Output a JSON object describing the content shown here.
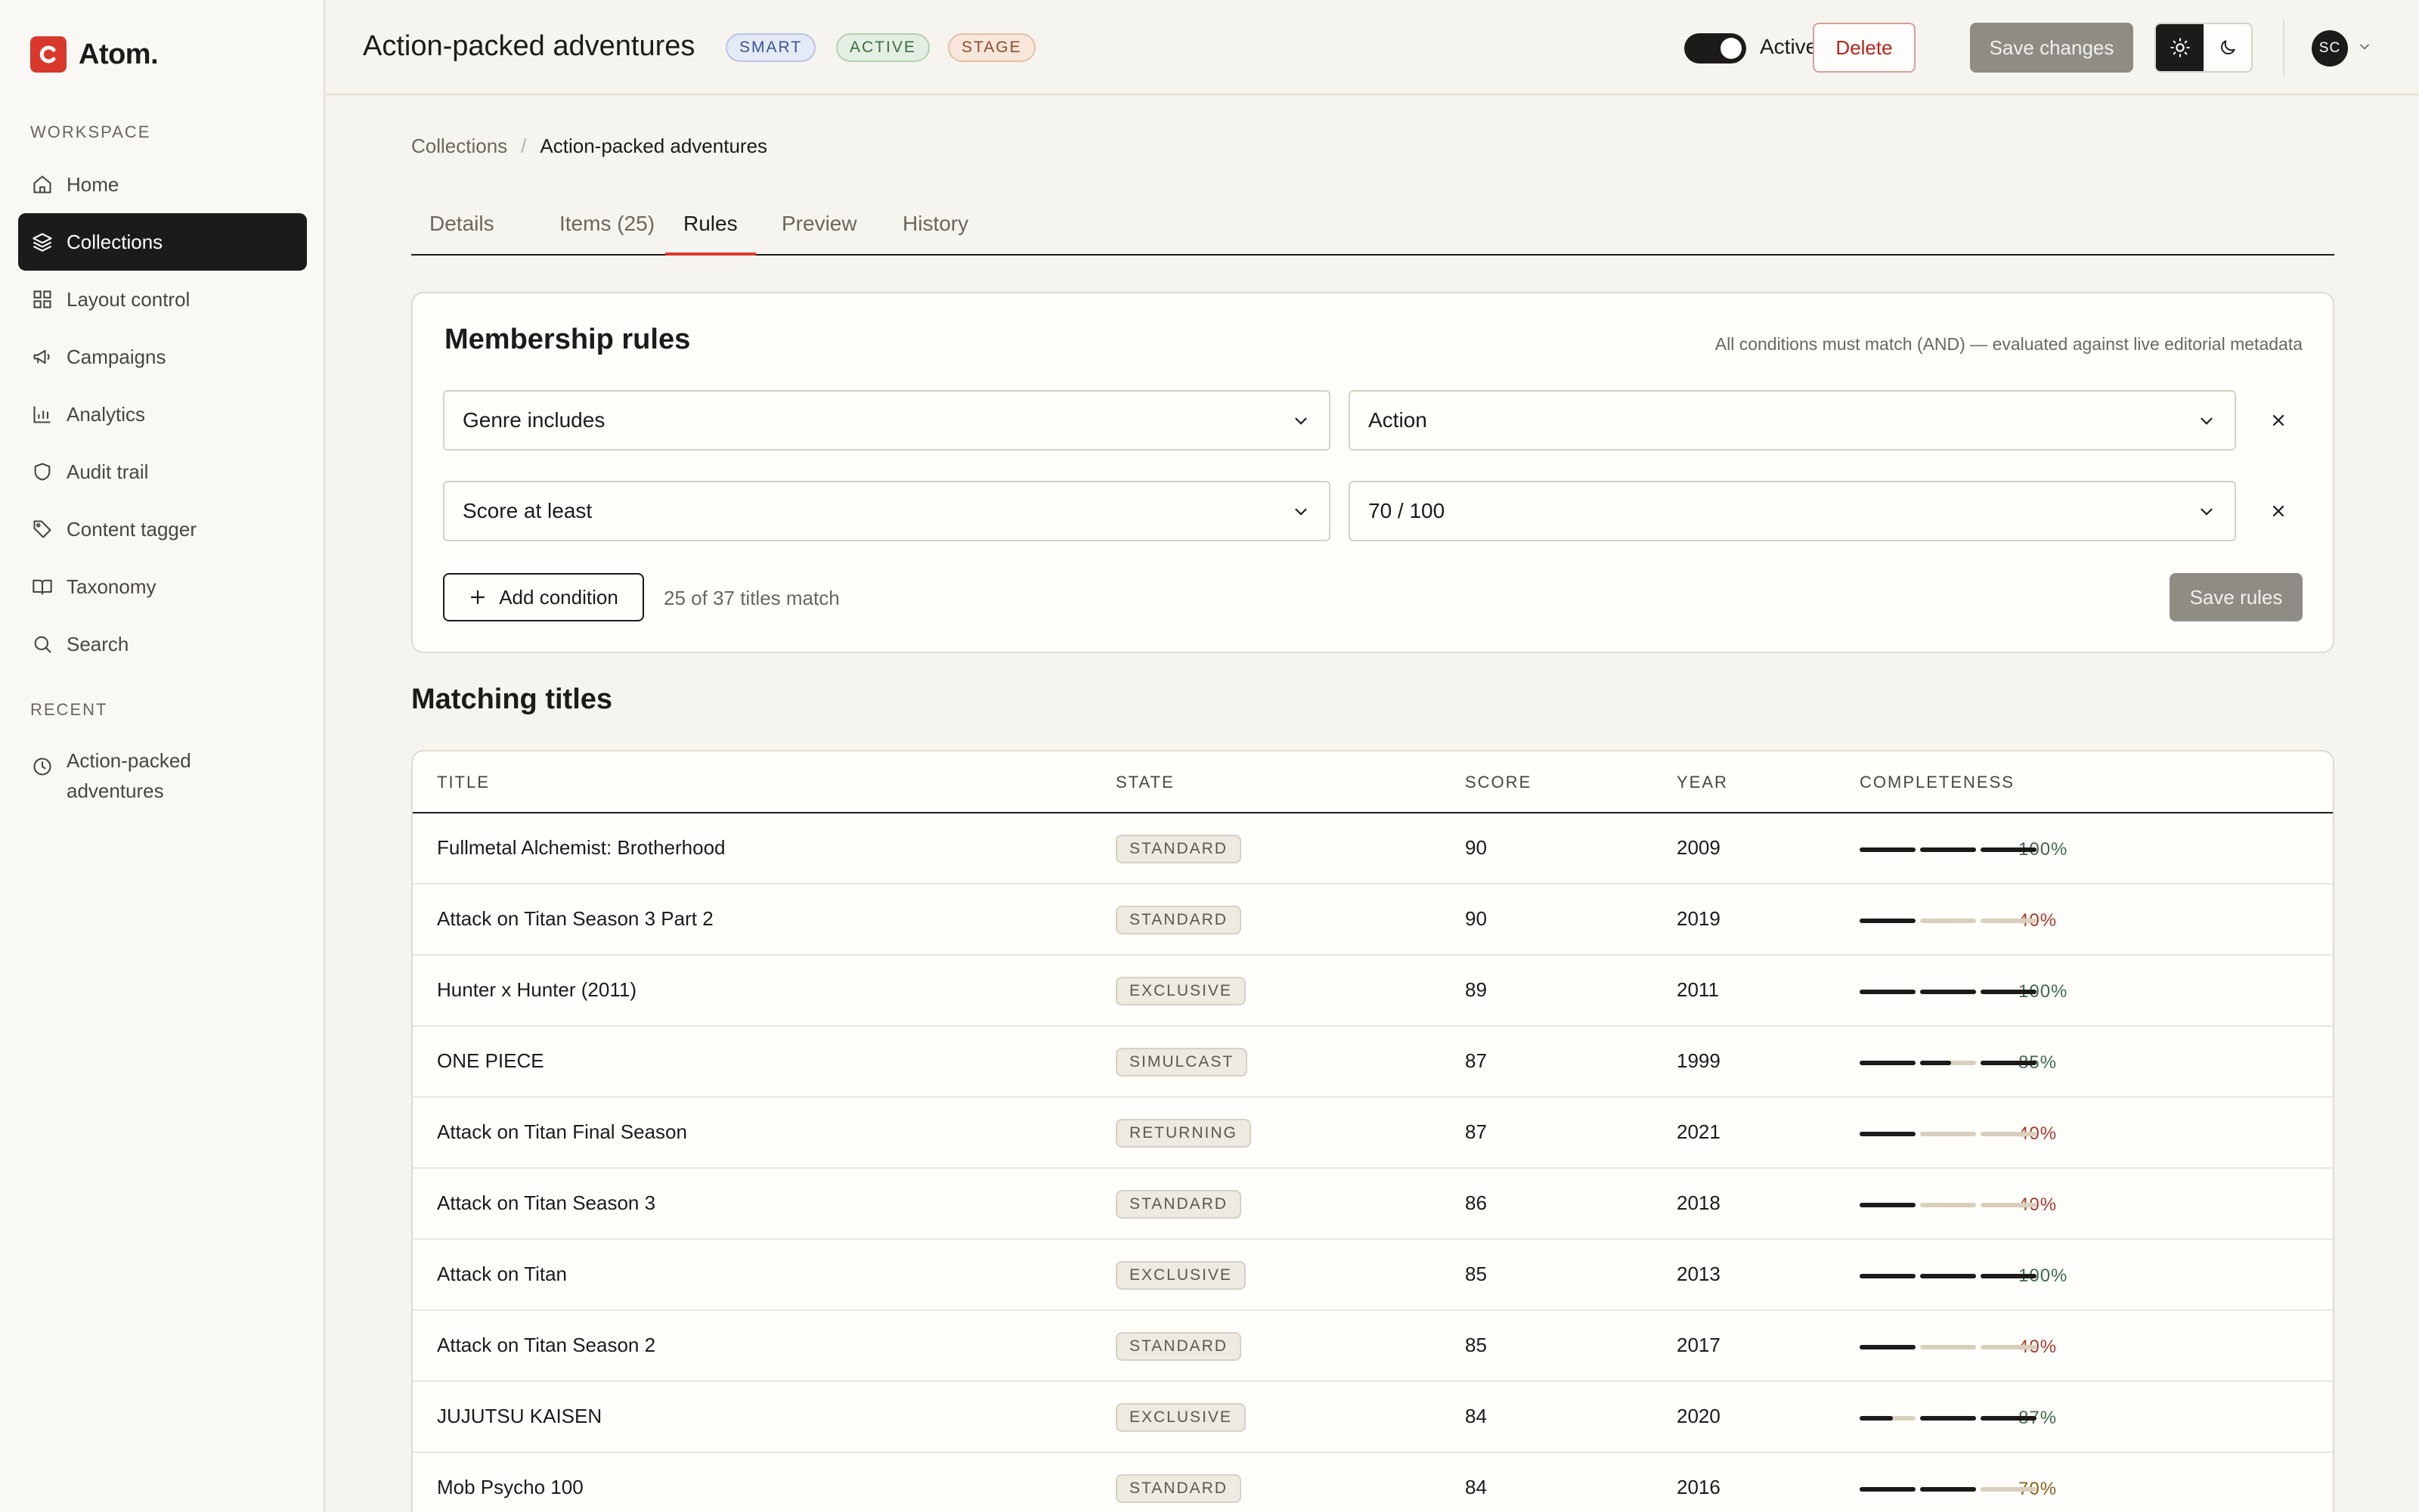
{
  "brand": {
    "name": "Atom."
  },
  "sidebar": {
    "workspace_label": "WORKSPACE",
    "items": [
      {
        "label": "Home",
        "icon": "home-icon"
      },
      {
        "label": "Collections",
        "icon": "layers-icon",
        "active": true
      },
      {
        "label": "Layout control",
        "icon": "grid-icon"
      },
      {
        "label": "Campaigns",
        "icon": "megaphone-icon"
      },
      {
        "label": "Analytics",
        "icon": "bar-chart-icon"
      },
      {
        "label": "Audit trail",
        "icon": "shield-icon"
      },
      {
        "label": "Content tagger",
        "icon": "tag-icon"
      },
      {
        "label": "Taxonomy",
        "icon": "book-icon"
      },
      {
        "label": "Search",
        "icon": "search-icon"
      }
    ],
    "recent_label": "RECENT",
    "recent_items": [
      {
        "label": "Action-packed adventures",
        "icon": "clock-icon"
      }
    ]
  },
  "header": {
    "title": "Action-packed adventures",
    "badges": [
      "SMART",
      "ACTIVE",
      "STAGE"
    ],
    "toggle_label": "Active",
    "toggle_on": true,
    "delete_label": "Delete",
    "save_label": "Save changes",
    "theme": "light",
    "avatar_initials": "SC"
  },
  "breadcrumb": {
    "parent": "Collections",
    "separator": "/",
    "current": "Action-packed adventures"
  },
  "tabs": [
    {
      "label": "Details"
    },
    {
      "label": "Items (25)"
    },
    {
      "label": "Rules",
      "active": true
    },
    {
      "label": "Preview"
    },
    {
      "label": "History"
    }
  ],
  "rules": {
    "title": "Membership rules",
    "note": "All conditions must match (AND) — evaluated against live editorial metadata",
    "conditions": [
      {
        "field": "Genre includes",
        "value": "Action"
      },
      {
        "field": "Score at least",
        "value": "70 / 100"
      }
    ],
    "add_label": "Add condition",
    "match_count": "25 of 37 titles match",
    "save_label": "Save rules"
  },
  "matching": {
    "title": "Matching titles",
    "columns": [
      "TITLE",
      "STATE",
      "SCORE",
      "YEAR",
      "COMPLETENESS"
    ],
    "rows": [
      {
        "title": "Fullmetal Alchemist: Brotherhood",
        "state": "STANDARD",
        "score": "90",
        "year": "2009",
        "completeness": "100%",
        "segments": [
          1,
          1,
          1
        ]
      },
      {
        "title": "Attack on Titan Season 3 Part 2",
        "state": "STANDARD",
        "score": "90",
        "year": "2019",
        "completeness": "40%",
        "segments": [
          1,
          0,
          0
        ]
      },
      {
        "title": "Hunter x Hunter (2011)",
        "state": "EXCLUSIVE",
        "score": "89",
        "year": "2011",
        "completeness": "100%",
        "segments": [
          1,
          1,
          1
        ]
      },
      {
        "title": "ONE PIECE",
        "state": "SIMULCAST",
        "score": "87",
        "year": "1999",
        "completeness": "85%",
        "segments": [
          1,
          0.55,
          1
        ]
      },
      {
        "title": "Attack on Titan Final Season",
        "state": "RETURNING",
        "score": "87",
        "year": "2021",
        "completeness": "40%",
        "segments": [
          1,
          0,
          0
        ]
      },
      {
        "title": "Attack on Titan Season 3",
        "state": "STANDARD",
        "score": "86",
        "year": "2018",
        "completeness": "40%",
        "segments": [
          1,
          0,
          0
        ]
      },
      {
        "title": "Attack on Titan",
        "state": "EXCLUSIVE",
        "score": "85",
        "year": "2013",
        "completeness": "100%",
        "segments": [
          1,
          1,
          1
        ]
      },
      {
        "title": "Attack on Titan Season 2",
        "state": "STANDARD",
        "score": "85",
        "year": "2017",
        "completeness": "40%",
        "segments": [
          1,
          0,
          0
        ]
      },
      {
        "title": "JUJUTSU KAISEN",
        "state": "EXCLUSIVE",
        "score": "84",
        "year": "2020",
        "completeness": "87%",
        "segments": [
          0.6,
          1,
          1
        ]
      },
      {
        "title": "Mob Psycho 100",
        "state": "STANDARD",
        "score": "84",
        "year": "2016",
        "completeness": "70%",
        "segments": [
          1,
          1,
          0
        ]
      }
    ]
  },
  "colors": {
    "accent": "#d9382c",
    "dark": "#1c1b19",
    "good": "#3d6b4b",
    "low": "#a63a2c",
    "mid": "#8b5e18",
    "track": "#d8d0bd"
  }
}
